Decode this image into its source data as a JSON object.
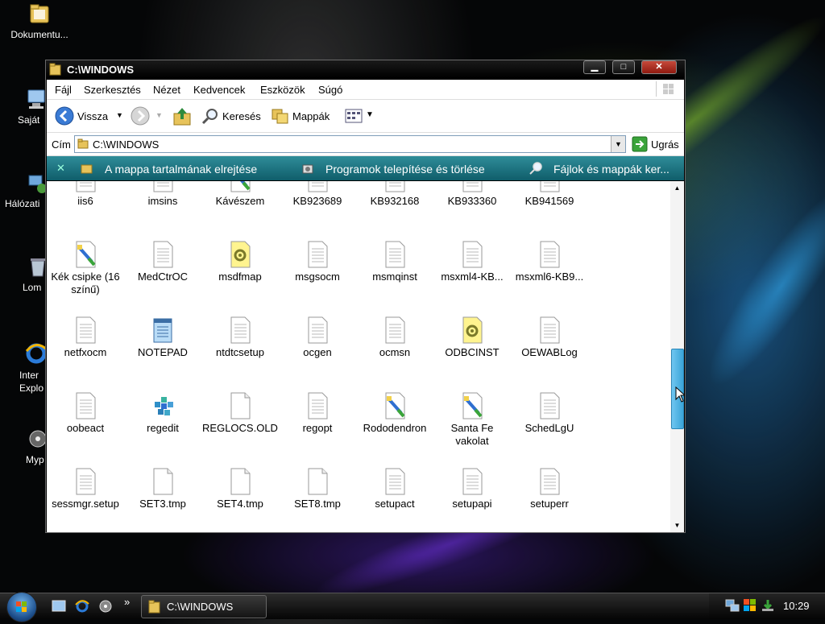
{
  "desktop": {
    "icons": [
      {
        "label": "Dokumentu...",
        "icon": "folder-icon"
      },
      {
        "label": "Saját",
        "icon": "computer-icon"
      },
      {
        "label": "Hálózati",
        "icon": "network-icon"
      },
      {
        "label": "Lom",
        "icon": "recycle-bin-icon"
      },
      {
        "label": "Inter Explo",
        "icon": "internet-explorer-icon"
      },
      {
        "label": "Myp",
        "icon": "media-icon"
      }
    ]
  },
  "window": {
    "title": "C:\\WINDOWS",
    "min_label": "▁",
    "max_label": "□",
    "close_label": "✕"
  },
  "menubar": {
    "items": [
      "Fájl",
      "Szerkesztés",
      "Nézet",
      "Kedvencek",
      "Eszközök",
      "Súgó"
    ]
  },
  "toolbar": {
    "back_label": "Vissza",
    "search_label": "Keresés",
    "folders_label": "Mappák"
  },
  "address": {
    "label": "Cím",
    "value": "C:\\WINDOWS",
    "go_label": "Ugrás"
  },
  "tasks": [
    "A mappa tartalmának elrejtése",
    "Programok telepítése és törlése",
    "Fájlok és mappák ker..."
  ],
  "files": [
    {
      "name": "iis6",
      "icon": "text-file-icon"
    },
    {
      "name": "imsins",
      "icon": "text-file-icon"
    },
    {
      "name": "Kávészem",
      "icon": "image-file-icon"
    },
    {
      "name": "KB923689",
      "icon": "text-file-icon"
    },
    {
      "name": "KB932168",
      "icon": "text-file-icon"
    },
    {
      "name": "KB933360",
      "icon": "text-file-icon"
    },
    {
      "name": "KB941569",
      "icon": "text-file-icon"
    },
    {
      "name": "Kék csipke (16 színű)",
      "icon": "image-file-icon"
    },
    {
      "name": "MedCtrOC",
      "icon": "text-file-icon"
    },
    {
      "name": "msdfmap",
      "icon": "config-file-icon"
    },
    {
      "name": "msgsocm",
      "icon": "text-file-icon"
    },
    {
      "name": "msmqinst",
      "icon": "text-file-icon"
    },
    {
      "name": "msxml4-KB...",
      "icon": "text-file-icon"
    },
    {
      "name": "msxml6-KB9...",
      "icon": "text-file-icon"
    },
    {
      "name": "netfxocm",
      "icon": "text-file-icon"
    },
    {
      "name": "NOTEPAD",
      "icon": "notepad-icon"
    },
    {
      "name": "ntdtcsetup",
      "icon": "text-file-icon"
    },
    {
      "name": "ocgen",
      "icon": "text-file-icon"
    },
    {
      "name": "ocmsn",
      "icon": "text-file-icon"
    },
    {
      "name": "ODBCINST",
      "icon": "config-file-icon"
    },
    {
      "name": "OEWABLog",
      "icon": "text-file-icon"
    },
    {
      "name": "oobeact",
      "icon": "text-file-icon"
    },
    {
      "name": "regedit",
      "icon": "regedit-icon"
    },
    {
      "name": "REGLOCS.OLD",
      "icon": "blank-file-icon"
    },
    {
      "name": "regopt",
      "icon": "text-file-icon"
    },
    {
      "name": "Rododendron",
      "icon": "image-file-icon"
    },
    {
      "name": "Santa Fe vakolat",
      "icon": "image-file-icon"
    },
    {
      "name": "SchedLgU",
      "icon": "text-file-icon"
    },
    {
      "name": "sessmgr.setup",
      "icon": "text-file-icon"
    },
    {
      "name": "SET3.tmp",
      "icon": "blank-file-icon"
    },
    {
      "name": "SET4.tmp",
      "icon": "blank-file-icon"
    },
    {
      "name": "SET8.tmp",
      "icon": "blank-file-icon"
    },
    {
      "name": "setupact",
      "icon": "text-file-icon"
    },
    {
      "name": "setupapi",
      "icon": "text-file-icon"
    },
    {
      "name": "setuperr",
      "icon": "text-file-icon"
    }
  ],
  "taskbar": {
    "window_label": "C:\\WINDOWS",
    "clock": "10:29",
    "quicklaunch_more": "»"
  },
  "colors": {
    "taskstrip": "#1f7684",
    "scroll_thumb": "#4fb3e4",
    "desktop_bg": "#050607"
  }
}
